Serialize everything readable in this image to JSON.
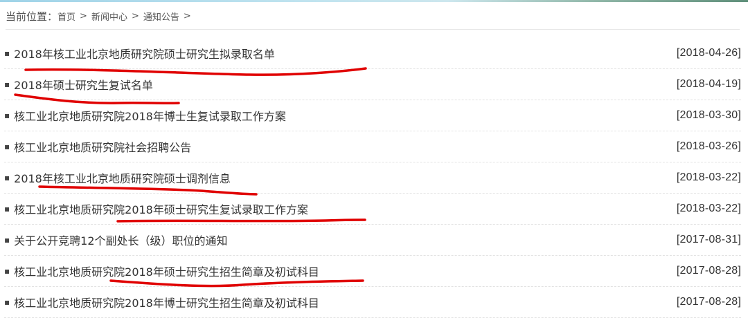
{
  "breadcrumb": {
    "label": "当前位置：",
    "items": [
      "首页",
      "新闻中心",
      "通知公告"
    ],
    "separator": ">"
  },
  "news": [
    {
      "title": "2018年核工业北京地质研究院硕士研究生拟录取名单",
      "date": "[2018-04-26]"
    },
    {
      "title": "2018年硕士研究生复试名单",
      "date": "[2018-04-19]"
    },
    {
      "title": "核工业北京地质研究院2018年博士生复试录取工作方案",
      "date": "[2018-03-30]"
    },
    {
      "title": "核工业北京地质研究院社会招聘公告",
      "date": "[2018-03-26]"
    },
    {
      "title": "2018年核工业北京地质研究院硕士调剂信息",
      "date": "[2018-03-22]"
    },
    {
      "title": "核工业北京地质研究院2018年硕士研究生复试录取工作方案",
      "date": "[2018-03-22]"
    },
    {
      "title": "关于公开竞聘12个副处长（级）职位的通知",
      "date": "[2017-08-31]"
    },
    {
      "title": "核工业北京地质研究院2018年硕士研究生招生简章及初试科目",
      "date": "[2017-08-28]"
    },
    {
      "title": "核工业北京地质研究院2018年博士研究生招生简章及初试科目",
      "date": "[2017-08-28]"
    }
  ],
  "annotation_color": "#e00000"
}
